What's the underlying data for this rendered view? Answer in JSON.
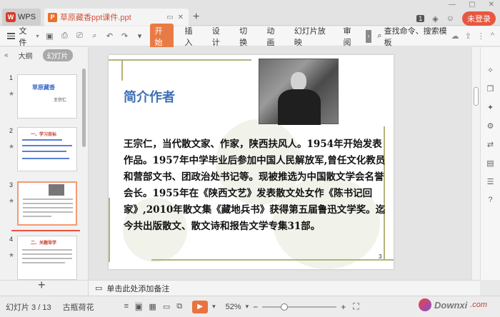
{
  "titlebar": {
    "app_tab": "WPS",
    "doc_tab": "草原藏香ppt课件.ppt",
    "login_button": "未登录",
    "notification_count": "1"
  },
  "ribbon": {
    "file_menu": "文件",
    "start_tab": "开始",
    "tabs": [
      "插入",
      "设计",
      "切换",
      "动画",
      "幻灯片放映",
      "审阅"
    ],
    "search": "查找命令、搜索模板"
  },
  "left_panel": {
    "outline_tab": "大纲",
    "slides_tab": "幻灯片",
    "thumbs": [
      {
        "num": "1",
        "title": "草原藏香",
        "subtitle": "王宗仁"
      },
      {
        "num": "2",
        "heading": "一、学习目标"
      },
      {
        "num": "3"
      },
      {
        "num": "4",
        "heading": "二、关题导学"
      }
    ],
    "add_button": "+"
  },
  "slide": {
    "title": "简介作者",
    "body": "王宗仁，当代散文家、作家，陕西扶风人。1954年开始发表作品。1957年中学毕业后参加中国人民解放军,曾任文化教员和营部文书、团政治处书记等。现被推选为中国散文学会名誉会长。1955年在《陕西文艺》发表散文处女作《陈书记回家》,2010年散文集《藏地兵书》获得第五届鲁迅文学奖。迄今共出版散文、散文诗和报告文学专集31部。",
    "page_number": "3"
  },
  "notes": {
    "placeholder": "单击此处添加备注"
  },
  "status": {
    "slide_count": "幻灯片 3 / 13",
    "theme": "古瓶荷花",
    "zoom": "52%"
  },
  "watermark": {
    "text": "Downxi",
    "suffix": ".com"
  }
}
